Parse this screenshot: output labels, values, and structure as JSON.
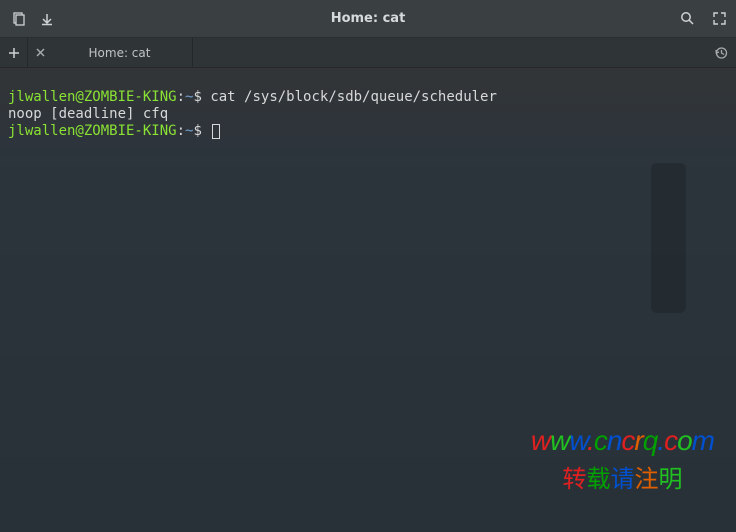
{
  "titlebar": {
    "title": "Home: cat"
  },
  "tabs": {
    "tab1_label": "Home: cat"
  },
  "terminal": {
    "line1_user": "jlwallen@ZOMBIE-KING",
    "line1_sep": ":",
    "line1_path": "~",
    "line1_prompt": "$",
    "line1_cmd": "cat /sys/block/sdb/queue/scheduler",
    "line2_output": "noop [deadline] cfq",
    "line3_user": "jlwallen@ZOMBIE-KING",
    "line3_sep": ":",
    "line3_path": "~",
    "line3_prompt": "$"
  },
  "watermark": {
    "url_w1": "w",
    "url_w2": "w",
    "url_w3": "w",
    "url_dot1": ".",
    "url_c": "c",
    "url_n": "n",
    "url_c2": "c",
    "url_r": "r",
    "url_q": "q",
    "url_dot2": ".",
    "url_c3": "c",
    "url_o": "o",
    "url_m": "m",
    "sub_1": "转",
    "sub_2": "载",
    "sub_3": "请",
    "sub_4": "注",
    "sub_5": "明"
  }
}
